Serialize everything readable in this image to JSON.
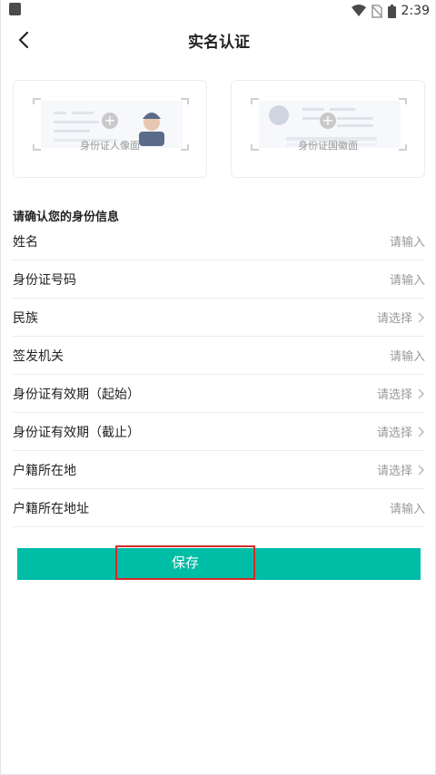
{
  "status_bar": {
    "time": "2:39"
  },
  "header": {
    "title": "实名认证"
  },
  "id_cards": [
    {
      "caption": "身份证人像面"
    },
    {
      "caption": "身份证国徽面"
    }
  ],
  "form": {
    "section_title": "请确认您的身份信息",
    "rows": [
      {
        "label": "姓名",
        "hint": "请输入"
      },
      {
        "label": "身份证号码",
        "hint": "请输入"
      },
      {
        "label": "民族",
        "hint": "请选择"
      },
      {
        "label": "签发机关",
        "hint": "请输入"
      },
      {
        "label": "身份证有效期（起始）",
        "hint": "请选择"
      },
      {
        "label": "身份证有效期（截止）",
        "hint": "请选择"
      },
      {
        "label": "户籍所在地",
        "hint": "请选择"
      },
      {
        "label": "户籍所在地址",
        "hint": "请输入"
      }
    ]
  },
  "actions": {
    "save_label": "保存"
  },
  "colors": {
    "accent": "#00bda5",
    "highlight_border": "#d42a2a"
  }
}
